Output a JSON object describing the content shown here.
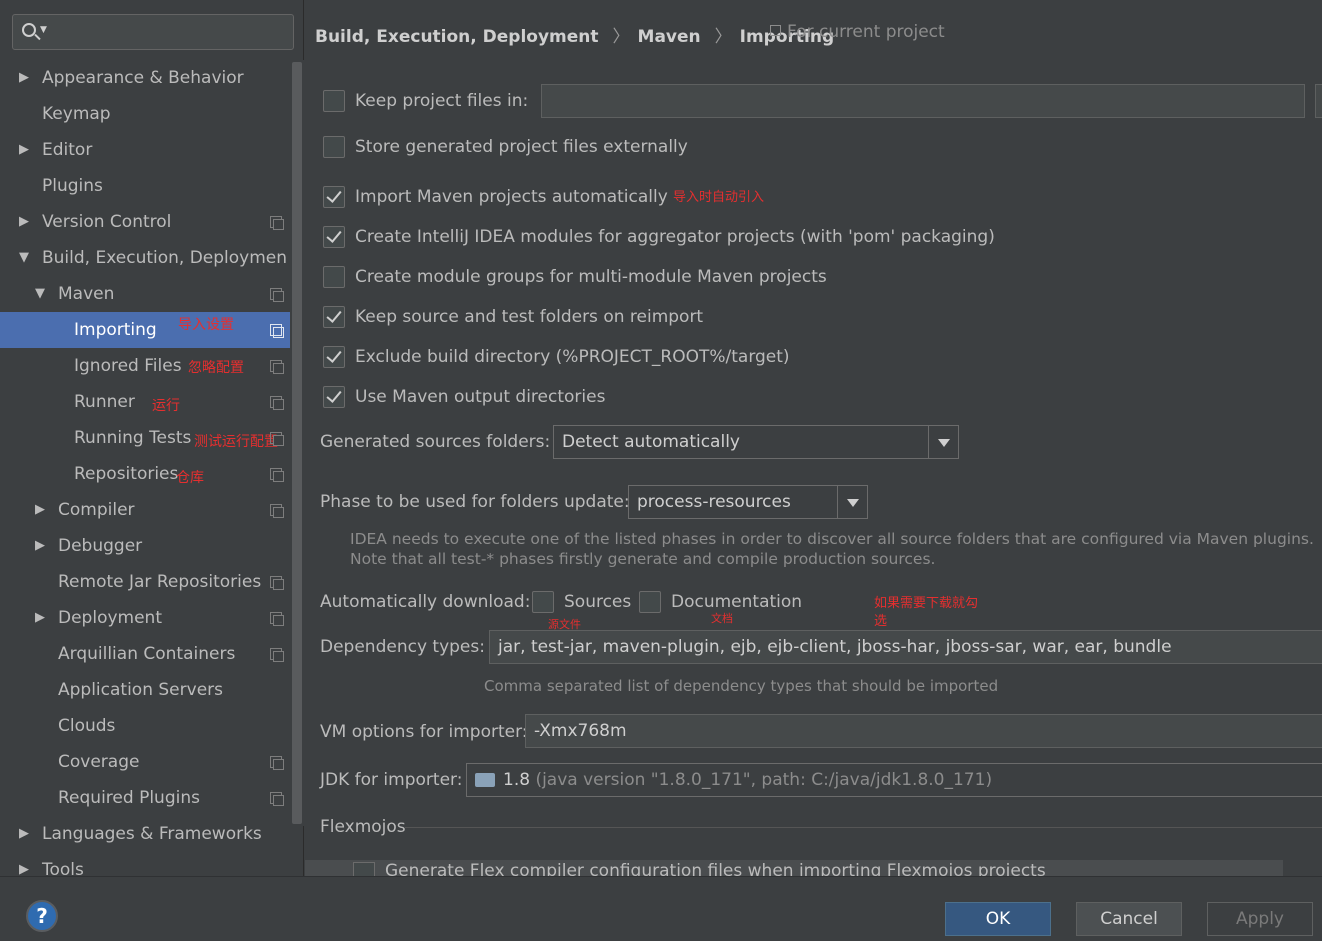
{
  "sidebar": {
    "search_placeholder": "",
    "items": [
      {
        "label": "Appearance & Behavior",
        "arrow": "▶"
      },
      {
        "label": "Keymap",
        "arrow": ""
      },
      {
        "label": "Editor",
        "arrow": "▶"
      },
      {
        "label": "Plugins",
        "arrow": ""
      },
      {
        "label": "Version Control",
        "arrow": "▶"
      },
      {
        "label": "Build, Execution, Deploymen",
        "arrow": "▼"
      },
      {
        "label": "Maven",
        "arrow": "▼"
      },
      {
        "label": "Importing",
        "arrow": ""
      },
      {
        "label": "Ignored Files",
        "arrow": ""
      },
      {
        "label": "Runner",
        "arrow": ""
      },
      {
        "label": "Running Tests",
        "arrow": ""
      },
      {
        "label": "Repositories",
        "arrow": ""
      },
      {
        "label": "Compiler",
        "arrow": "▶"
      },
      {
        "label": "Debugger",
        "arrow": "▶"
      },
      {
        "label": "Remote Jar Repositories",
        "arrow": ""
      },
      {
        "label": "Deployment",
        "arrow": "▶"
      },
      {
        "label": "Arquillian Containers",
        "arrow": ""
      },
      {
        "label": "Application Servers",
        "arrow": ""
      },
      {
        "label": "Clouds",
        "arrow": ""
      },
      {
        "label": "Coverage",
        "arrow": ""
      },
      {
        "label": "Required Plugins",
        "arrow": ""
      },
      {
        "label": "Languages & Frameworks",
        "arrow": "▶"
      },
      {
        "label": "Tools",
        "arrow": "▶"
      }
    ],
    "annotations": {
      "importing": "导入设置",
      "ignored_files": "忽略配置",
      "runner": "运行",
      "running_tests": "测试运行配置",
      "repositories": "仓库"
    }
  },
  "breadcrumb": {
    "parts": [
      "Build, Execution, Deployment",
      "Maven",
      "Importing"
    ],
    "separator": "〉",
    "scope": "For current project"
  },
  "options": {
    "keep_files_in": {
      "label": "Keep project files in:",
      "checked": false,
      "value": ""
    },
    "store_externally": {
      "label": "Store generated project files externally",
      "checked": false
    },
    "import_auto": {
      "label": "Import Maven projects automatically",
      "checked": true,
      "annotation": "导入时自动引入"
    },
    "create_modules": {
      "label": "Create IntelliJ IDEA modules for aggregator projects (with 'pom' packaging)",
      "checked": true
    },
    "module_groups": {
      "label": "Create module groups for multi-module Maven projects",
      "checked": false
    },
    "keep_source": {
      "label": "Keep source and test folders on reimport",
      "checked": true
    },
    "exclude_build": {
      "label": "Exclude build directory (%PROJECT_ROOT%/target)",
      "checked": true
    },
    "use_output": {
      "label": "Use Maven output directories",
      "checked": true
    }
  },
  "generated_sources": {
    "label": "Generated sources folders:",
    "value": "Detect automatically"
  },
  "phase": {
    "label": "Phase to be used for folders update:",
    "value": "process-resources",
    "help_line1": "IDEA needs to execute one of the listed phases in order to discover all source folders that are configured via Maven plugins.",
    "help_line2": "Note that all test-* phases firstly generate and compile production sources."
  },
  "auto_download": {
    "label": "Automatically download:",
    "sources": {
      "label": "Sources",
      "checked": false,
      "annotation": "源文件"
    },
    "documentation": {
      "label": "Documentation",
      "checked": false,
      "annotation": "文档"
    },
    "annotation_line1": "如果需要下载就勾",
    "annotation_line2": "选"
  },
  "dependency_types": {
    "label": "Dependency types:",
    "value": "jar, test-jar, maven-plugin, ejb, ejb-client, jboss-har, jboss-sar, war, ear, bundle",
    "help": "Comma separated list of dependency types that should be imported"
  },
  "vm_options": {
    "label": "VM options for importer:",
    "value": "-Xmx768m"
  },
  "jdk": {
    "label": "JDK for importer:",
    "version": "1.8",
    "details": "(java version \"1.8.0_171\", path: C:/java/jdk1.8.0_171)",
    "icon": "folder-icon"
  },
  "flexmojos": {
    "title": "Flexmojos",
    "cut_option": "Generate Flex compiler configuration files when importing Flexmojos projects"
  },
  "buttons": {
    "help": "?",
    "ok": "OK",
    "cancel": "Cancel",
    "apply": "Apply"
  },
  "colors": {
    "selection": "#4b6eaf",
    "background": "#3c3f41",
    "annotation": "#e52f2f",
    "ok_button": "#365880"
  }
}
